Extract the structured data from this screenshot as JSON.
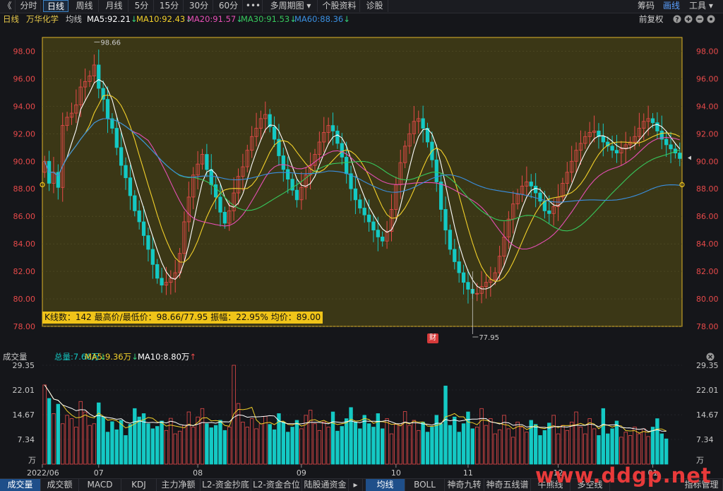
{
  "toolbar": {
    "back_glyph": "《",
    "periods": [
      "分时",
      "日线",
      "周线",
      "月线",
      "5分",
      "15分",
      "30分",
      "60分",
      "•••",
      "多周期图",
      "个股资料",
      "诊股"
    ],
    "active_period": "日线",
    "right_items": [
      "筹码",
      "画线",
      "工具"
    ],
    "active_right": "画线",
    "dropdown_glyph": "▾"
  },
  "kline_header": {
    "period": "日线",
    "stock": "万华化学",
    "avg_label": "均线",
    "ma": [
      {
        "label": "MA5:92.21",
        "color": "#ffffff",
        "arrow": "down"
      },
      {
        "label": "MA10:92.43",
        "color": "#f2d02a",
        "arrow": "down"
      },
      {
        "label": "MA20:91.57",
        "color": "#e64fb5",
        "arrow": "down"
      },
      {
        "label": "MA30:91.53",
        "color": "#37c75c",
        "arrow": "down"
      },
      {
        "label": "MA60:88.36",
        "color": "#3a8fe0",
        "arrow": "down"
      }
    ],
    "fuquan": "前复权",
    "icons": [
      "help-icon",
      "zoom-in-icon",
      "zoom-out-icon",
      "settings-icon"
    ]
  },
  "stats_label": "K线数：142 最高价/最低价：98.66/77.95 振幅：22.95% 均价：89.00",
  "fin_badge": "财",
  "volume_header": {
    "title": "成交量",
    "total": "总量:7.66万",
    "ma5": "MA5:9.36万",
    "ma10": "MA10:8.80万"
  },
  "bottom_tabs": {
    "left": [
      "成交量",
      "成交额",
      "MACD",
      "KDJ",
      "主力净额",
      "L2-资金抄底",
      "L2-资金合位",
      "陆股通资金"
    ],
    "right": [
      "均线",
      "BOLL",
      "神奇九转",
      "神奇五线谱",
      "牛熊线",
      "多空线"
    ],
    "active_left": "成交量",
    "active_right": "均线",
    "manage": "指标管理"
  },
  "watermark": "www.ddgp.net",
  "colors": {
    "up": "#e84a4a",
    "down": "#14c9c4",
    "accent": "#f0c419"
  },
  "chart_data": {
    "type": "candlestick",
    "title": "万华化学 日线",
    "x_ticks": [
      {
        "label": "2022/06",
        "index": 0
      },
      {
        "label": "07",
        "index": 12
      },
      {
        "label": "08",
        "index": 34
      },
      {
        "label": "09",
        "index": 57
      },
      {
        "label": "10",
        "index": 78
      },
      {
        "label": "11",
        "index": 94
      },
      {
        "label": "12",
        "index": 114
      },
      {
        "label": "01",
        "index": 135
      }
    ],
    "price_axis": {
      "ylim": [
        78,
        99
      ],
      "ticks": [
        98,
        96,
        94,
        92,
        90,
        88,
        86,
        84,
        82,
        80,
        78
      ]
    },
    "volume_axis": {
      "ylim": [
        0,
        29.35
      ],
      "ticks": [
        29.35,
        22.01,
        14.67,
        7.34
      ],
      "unit": "万"
    },
    "high": 98.66,
    "low": 77.95,
    "high_label": "98.66",
    "low_label": "77.95",
    "candles_close": [
      90,
      88.4,
      89.2,
      88.1,
      92.6,
      93.2,
      93.5,
      94.1,
      95.4,
      95.8,
      96.2,
      97.0,
      95.3,
      94.5,
      93.1,
      92.4,
      91.0,
      89.7,
      88.8,
      87.5,
      86.4,
      85.6,
      84.6,
      83.6,
      82.5,
      81.5,
      81.0,
      81.2,
      81.5,
      81.9,
      83.3,
      85.6,
      87.4,
      89.0,
      89.8,
      90.5,
      89.4,
      88.3,
      87.4,
      86.3,
      85.5,
      86.4,
      87.7,
      88.9,
      89.6,
      90.8,
      91.8,
      92.4,
      93.1,
      93.4,
      92.5,
      91.6,
      90.4,
      89.4,
      88.7,
      87.9,
      87.2,
      88.1,
      89.0,
      89.7,
      90.5,
      91.4,
      92.1,
      92.6,
      92.2,
      91.3,
      90.3,
      89.1,
      88.0,
      87.2,
      86.6,
      86.1,
      85.6,
      85.0,
      84.5,
      84.2,
      84.9,
      86.5,
      88.3,
      89.9,
      91.1,
      92.0,
      92.9,
      93.1,
      92.4,
      91.4,
      90.1,
      88.5,
      86.5,
      85.0,
      83.6,
      82.7,
      81.9,
      81.2,
      80.7,
      80.4,
      80.4,
      80.9,
      81.2,
      81.4,
      81.9,
      83.1,
      84.5,
      85.8,
      86.9,
      87.6,
      88.2,
      88.5,
      88.2,
      87.7,
      87.1,
      86.4,
      86.2,
      86.7,
      87.4,
      88.4,
      89.2,
      90.0,
      90.8,
      91.3,
      91.8,
      92.1,
      92.2,
      91.8,
      91.4,
      91.1,
      90.8,
      90.6,
      90.9,
      91.2,
      91.4,
      91.8,
      92.4,
      92.9,
      93.1,
      92.8,
      92.2,
      91.6,
      91.2,
      90.9,
      90.6,
      90.2
    ],
    "candles_open": [
      89.2,
      90,
      88.4,
      89.2,
      88.1,
      92.6,
      93.2,
      93.5,
      94.1,
      95.4,
      95.8,
      96.2,
      97.0,
      95.3,
      94.5,
      93.1,
      92.4,
      91.0,
      89.7,
      88.8,
      87.5,
      86.4,
      85.6,
      84.6,
      83.6,
      82.5,
      81.5,
      81.0,
      81.2,
      81.5,
      81.9,
      83.3,
      85.6,
      87.4,
      89.0,
      89.8,
      90.5,
      89.4,
      88.3,
      87.4,
      86.3,
      85.5,
      86.4,
      87.7,
      88.9,
      89.6,
      90.8,
      91.8,
      92.4,
      93.1,
      93.4,
      92.5,
      91.6,
      90.4,
      89.4,
      88.7,
      87.9,
      87.2,
      88.1,
      89.0,
      89.7,
      90.5,
      91.4,
      92.1,
      92.6,
      92.2,
      91.3,
      90.3,
      89.1,
      88.0,
      87.2,
      86.6,
      86.1,
      85.6,
      85.0,
      84.5,
      84.2,
      84.9,
      86.5,
      88.3,
      89.9,
      91.1,
      92.0,
      92.9,
      93.1,
      92.4,
      91.4,
      90.1,
      88.5,
      86.5,
      85.0,
      83.6,
      82.7,
      81.9,
      81.2,
      80.7,
      80.4,
      80.4,
      80.9,
      81.2,
      81.4,
      81.9,
      83.1,
      84.5,
      85.8,
      86.9,
      87.6,
      88.2,
      88.5,
      88.2,
      87.7,
      87.1,
      86.4,
      86.2,
      86.7,
      87.4,
      88.4,
      89.2,
      90.0,
      90.8,
      91.3,
      91.8,
      92.1,
      92.2,
      91.8,
      91.4,
      91.1,
      90.8,
      90.6,
      90.9,
      91.2,
      91.4,
      91.8,
      92.4,
      92.9,
      93.1,
      92.8,
      92.2,
      91.6,
      91.2,
      90.9,
      90.6
    ],
    "volume": [
      23.5,
      19.5,
      15.0,
      17.8,
      12.0,
      14.5,
      13.5,
      11.0,
      18.6,
      15.5,
      11.5,
      12.0,
      18.2,
      14.0,
      9.5,
      12.6,
      10.2,
      13.0,
      8.5,
      11.8,
      16.5,
      14.0,
      15.0,
      12.0,
      10.5,
      11.2,
      12.8,
      10.0,
      13.6,
      9.0,
      9.8,
      11.5,
      15.5,
      11.0,
      14.0,
      16.5,
      12.0,
      10.8,
      11.5,
      13.0,
      10.0,
      11.0,
      29.35,
      18.0,
      12.5,
      11.0,
      13.5,
      10.5,
      12.0,
      14.2,
      11.8,
      10.2,
      15.0,
      12.5,
      9.5,
      11.0,
      13.0,
      10.5,
      14.5,
      16.0,
      12.0,
      10.0,
      12.5,
      11.0,
      15.5,
      9.8,
      11.2,
      13.5,
      16.8,
      12.5,
      10.5,
      14.5,
      12.0,
      11.0,
      15.0,
      10.5,
      13.5,
      9.0,
      11.8,
      12.0,
      15.6,
      11.5,
      13.0,
      10.0,
      12.5,
      9.5,
      11.0,
      14.5,
      12.0,
      23.2,
      11.5,
      14.0,
      9.5,
      12.0,
      15.5,
      10.5,
      11.0,
      16.5,
      11.5,
      13.5,
      9.0,
      10.2,
      14.5,
      10.5,
      8.0,
      12.5,
      11.0,
      9.5,
      13.0,
      11.8,
      8.5,
      10.0,
      12.2,
      14.5,
      9.0,
      11.5,
      10.0,
      12.5,
      15.5,
      11.0,
      9.0,
      13.5,
      10.5,
      8.5,
      16.5,
      9.0,
      10.5,
      12.8,
      8.0,
      9.5,
      8.5,
      11.0,
      9.0,
      10.5,
      8.2,
      11.0,
      13.5,
      9.0,
      7.5
    ],
    "ma_colors": {
      "ma5": "#ffffff",
      "ma10": "#f2d02a",
      "ma20": "#e64fb5",
      "ma30": "#37c75c",
      "ma60": "#3a8fe0"
    }
  }
}
